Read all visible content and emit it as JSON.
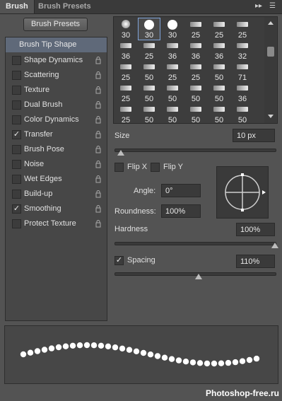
{
  "tabs": {
    "brush": "Brush",
    "presets": "Brush Presets"
  },
  "top_button": "Brush Presets",
  "left_menu": {
    "header": "Brush Tip Shape",
    "items": [
      {
        "label": "Shape Dynamics",
        "checked": false
      },
      {
        "label": "Scattering",
        "checked": false
      },
      {
        "label": "Texture",
        "checked": false
      },
      {
        "label": "Dual Brush",
        "checked": false
      },
      {
        "label": "Color Dynamics",
        "checked": false
      },
      {
        "label": "Transfer",
        "checked": true
      },
      {
        "label": "Brush Pose",
        "checked": false
      },
      {
        "label": "Noise",
        "checked": false
      },
      {
        "label": "Wet Edges",
        "checked": false
      },
      {
        "label": "Build-up",
        "checked": false
      },
      {
        "label": "Smoothing",
        "checked": true
      },
      {
        "label": "Protect Texture",
        "checked": false
      }
    ]
  },
  "preset_sizes": [
    "30",
    "30",
    "30",
    "25",
    "25",
    "25",
    "36",
    "25",
    "36",
    "36",
    "36",
    "32",
    "25",
    "50",
    "25",
    "25",
    "50",
    "71",
    "25",
    "50",
    "50",
    "50",
    "50",
    "36",
    "25",
    "50",
    "50",
    "50",
    "50",
    "50"
  ],
  "controls": {
    "size_label": "Size",
    "size_value": "10 px",
    "flip_x": "Flip X",
    "flip_y": "Flip Y",
    "angle_label": "Angle:",
    "angle_value": "0°",
    "roundness_label": "Roundness:",
    "roundness_value": "100%",
    "hardness_label": "Hardness",
    "hardness_value": "100%",
    "spacing_label": "Spacing",
    "spacing_value": "110%",
    "spacing_checked": true
  },
  "watermark": "Photoshop-free.ru"
}
